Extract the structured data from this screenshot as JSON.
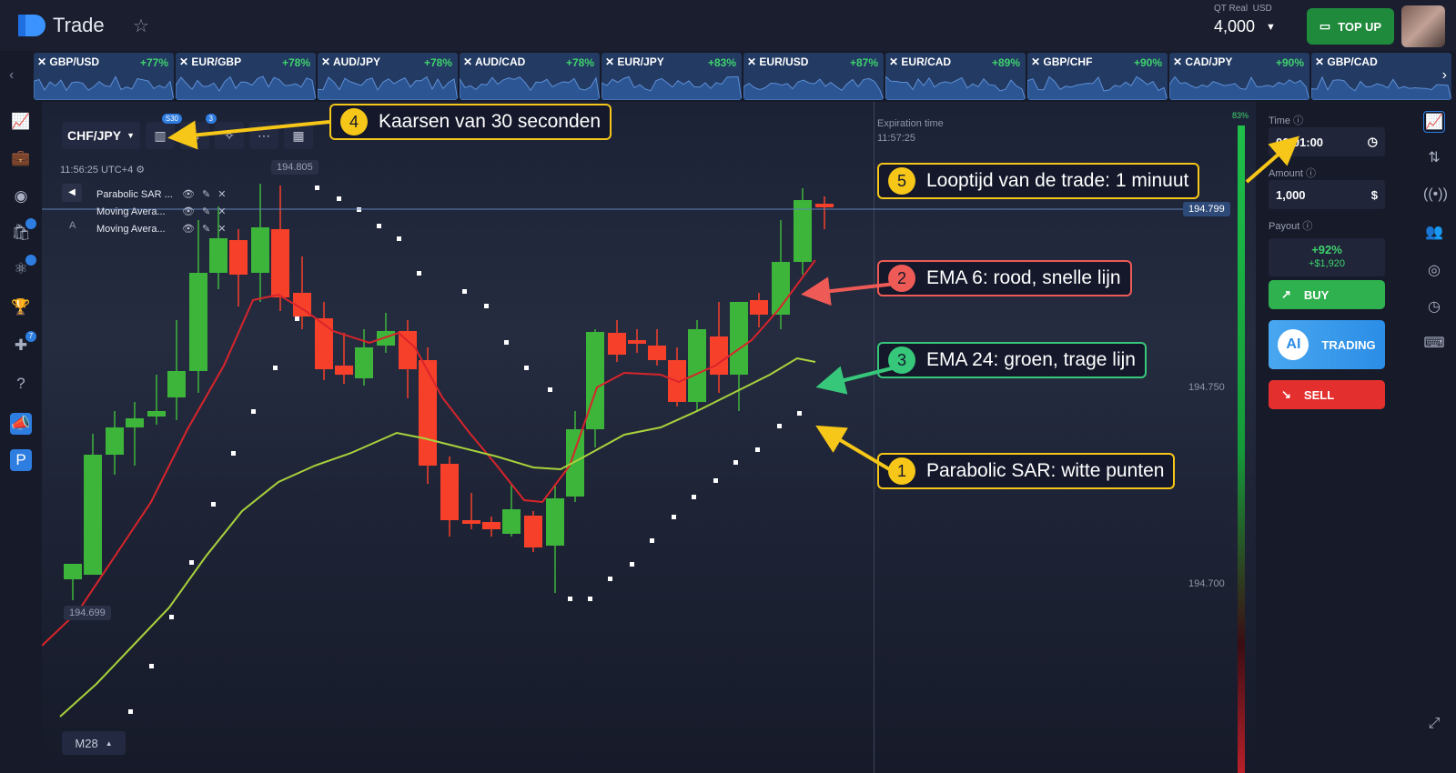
{
  "app": {
    "name": "Trade"
  },
  "account": {
    "type": "QT Real",
    "currency": "USD",
    "balance": "4,000",
    "topup_label": "TOP UP"
  },
  "pairs": [
    {
      "name": "GBP/USD",
      "pct": "+77%"
    },
    {
      "name": "EUR/GBP",
      "pct": "+78%"
    },
    {
      "name": "AUD/JPY",
      "pct": "+78%"
    },
    {
      "name": "AUD/CAD",
      "pct": "+78%"
    },
    {
      "name": "EUR/JPY",
      "pct": "+83%"
    },
    {
      "name": "EUR/USD",
      "pct": "+87%"
    },
    {
      "name": "EUR/CAD",
      "pct": "+89%"
    },
    {
      "name": "GBP/CHF",
      "pct": "+90%"
    },
    {
      "name": "CAD/JPY",
      "pct": "+90%"
    },
    {
      "name": "GBP/CAD",
      "pct": ""
    }
  ],
  "left_nav": {
    "badges": [
      "7"
    ]
  },
  "chart": {
    "symbol": "CHF/JPY",
    "timeframe_badge": "S30",
    "draw_badge": "3",
    "time": "11:56:25 UTC+4",
    "indicators": [
      "Parabolic SAR ...",
      "Moving Avera...",
      "Moving Avera..."
    ],
    "top_price": "194.805",
    "current_price": "194.799",
    "low_price": "194.699",
    "price_labels": [
      "194.750",
      "194.700"
    ],
    "expiration_label": "Expiration time",
    "expiration_time": "11:57:25",
    "balance_pct": "83%",
    "zoom_label": "M28"
  },
  "callouts": {
    "c1": {
      "num": "1",
      "text": "Parabolic SAR: witte punten"
    },
    "c2": {
      "num": "2",
      "text": "EMA 6: rood, snelle lijn"
    },
    "c3": {
      "num": "3",
      "text": "EMA 24: groen, trage lijn"
    },
    "c4": {
      "num": "4",
      "text": "Kaarsen van 30 seconden"
    },
    "c5": {
      "num": "5",
      "text": "Looptijd van de trade: 1 minuut"
    }
  },
  "trade_panel": {
    "time_label": "Time",
    "time_value": "00:01:00",
    "amount_label": "Amount",
    "amount_value": "1,000",
    "payout_label": "Payout",
    "payout_pct": "+92%",
    "payout_value": "+$1,920",
    "buy_label": "BUY",
    "ai_label": "TRADING",
    "ai_icon": "AI",
    "sell_label": "SELL"
  },
  "colors": {
    "up": "#3db53a",
    "down": "#f7402a",
    "ema_fast": "#d8242b",
    "ema_slow": "#a9d23c",
    "sar": "#ffffff",
    "accent": "#2e7de0"
  }
}
